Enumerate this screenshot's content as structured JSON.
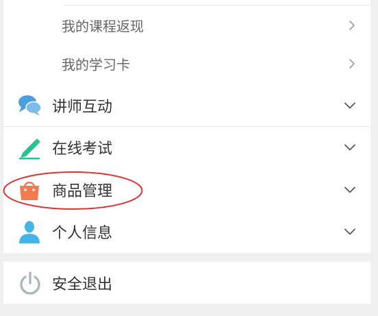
{
  "menu": {
    "sub_items": [
      {
        "label": "我的课程返现",
        "icon": "chevron-right-icon"
      },
      {
        "label": "我的学习卡",
        "icon": "chevron-right-icon"
      }
    ],
    "items": [
      {
        "label": "讲师互动",
        "icon": "chat-bubbles-icon",
        "color": "#4a9fe0"
      },
      {
        "label": "在线考试",
        "icon": "pencil-icon",
        "color": "#2bbf94"
      },
      {
        "label": "商品管理",
        "icon": "shopping-bag-icon",
        "color": "#f47a4f",
        "highlighted": true
      },
      {
        "label": "个人信息",
        "icon": "person-icon",
        "color": "#45b5e6"
      }
    ]
  },
  "logout": {
    "label": "安全退出",
    "icon": "power-icon",
    "color": "#a9b9bb"
  },
  "colors": {
    "background": "#f0f0f0",
    "card": "#ffffff",
    "highlight_ring": "#e03030",
    "chevron": "#999999"
  }
}
